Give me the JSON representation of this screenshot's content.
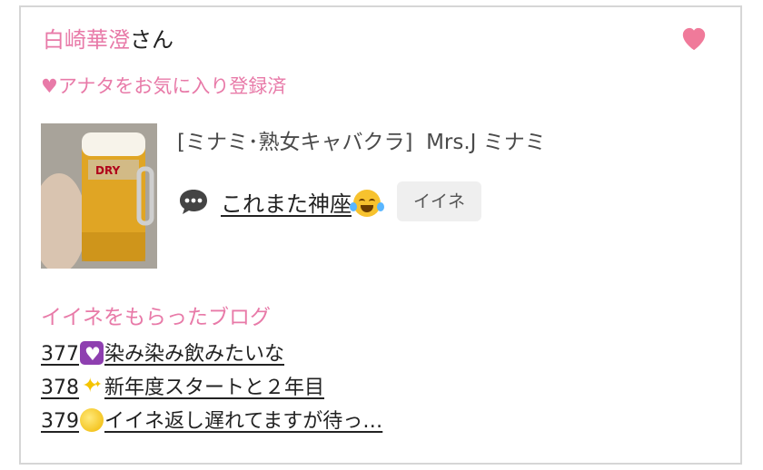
{
  "header": {
    "user_name": "白崎華澄",
    "honorific": "さん"
  },
  "favorite_status": "♥アナタをお気に入り登録済",
  "post": {
    "shop": "[ミナミ･熟女キャバクラ]",
    "author": "Mrs.J ミナミ",
    "comment": "これまた神座",
    "like_label": "イイネ"
  },
  "liked_blogs": {
    "title": "イイネをもらったブログ",
    "items": [
      {
        "number": "377",
        "icon": "purple-heart",
        "text": "染み染み飲みたいな"
      },
      {
        "number": "378",
        "icon": "sparkles",
        "text": "新年度スタートと２年目"
      },
      {
        "number": "379",
        "icon": "glowing-star",
        "text": "イイネ返し遅れてますが待っ…"
      }
    ]
  },
  "colors": {
    "accent_pink": "#e87aa8",
    "heart": "#f07a9a"
  }
}
